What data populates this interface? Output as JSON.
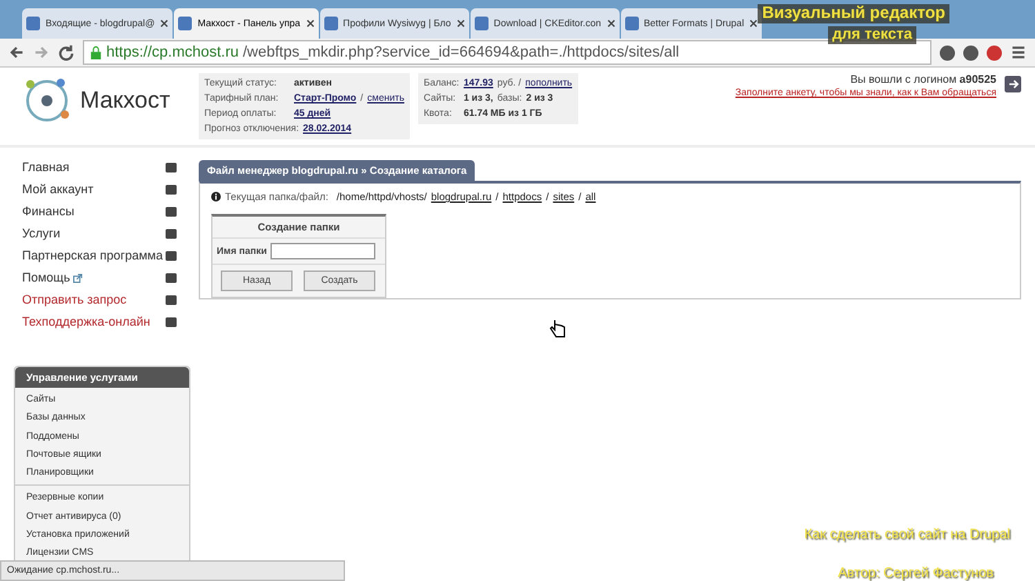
{
  "browser": {
    "tabs": [
      {
        "label": "Входящие - blogdrupal@",
        "selected": false
      },
      {
        "label": "Макхост - Панель упра",
        "selected": true
      },
      {
        "label": "Профили Wysiwyg | Бло",
        "selected": false
      },
      {
        "label": "Download | CKEditor.con",
        "selected": false
      },
      {
        "label": "Better Formats | Drupal",
        "selected": false
      }
    ],
    "url_host": "https://cp.mchost.ru",
    "url_path": "/webftps_mkdir.php?service_id=664694&path=./httpdocs/sites/all"
  },
  "header": {
    "logo": "Макхост",
    "status": [
      {
        "label": "Текущий статус:",
        "value": "активен"
      },
      {
        "label": "Тарифный план:",
        "value": "Старт-Промо",
        "sep": "/",
        "link": "сменить"
      },
      {
        "label": "Период оплаты:",
        "value": "45 дней"
      },
      {
        "label": "Прогноз отключения:",
        "value": "28.02.2014"
      }
    ],
    "account": [
      {
        "label": "Баланс:",
        "value": "147.93",
        "rest": "руб. /",
        "link": "пополнить"
      },
      {
        "label": "Сайты:",
        "value": "1 из 3,",
        "rest": "базы:",
        "value2": "2 из 3"
      },
      {
        "label": "Квота:",
        "value": "61.74 МБ из 1 ГБ"
      }
    ],
    "login_text": "Вы вошли с логином",
    "login": "a90525",
    "profile_link": "Заполните анкету, чтобы мы знали, как к Вам обращаться"
  },
  "sidebar": {
    "items": [
      {
        "label": "Главная",
        "kind": "normal"
      },
      {
        "label": "Мой аккаунт",
        "kind": "normal"
      },
      {
        "label": "Финансы",
        "kind": "normal"
      },
      {
        "label": "Услуги",
        "kind": "normal"
      },
      {
        "label": "Партнерская программа",
        "kind": "normal"
      },
      {
        "label": "Помощь",
        "kind": "external"
      },
      {
        "label": "Отправить запрос",
        "kind": "alert"
      },
      {
        "label": "Техподдержка-онлайн",
        "kind": "alert"
      }
    ],
    "services": {
      "title": "Управление услугами",
      "groups": [
        [
          "Сайты",
          "Базы данных",
          "Поддомены",
          "Почтовые ящики",
          "Планировщики"
        ],
        [
          "Резервные копии",
          "Отчет антивируса (0)",
          "Установка приложений",
          "Лицензии CMS"
        ]
      ]
    }
  },
  "panel": {
    "title": "Файл менеджер blogdrupal.ru » Создание каталога",
    "path_label": "Текущая папка/файл:",
    "path_prefix": "/home/httpd/vhosts/",
    "path_links": [
      "blogdrupal.ru",
      "httpdocs",
      "sites",
      "all"
    ],
    "path_separator": "/",
    "form": {
      "title": "Создание папки",
      "field_label": "Имя папки",
      "buttons": [
        "Назад",
        "Создать"
      ]
    }
  },
  "status_bar": "Ожидание cp.mchost.ru...",
  "captions": [
    "Визуальный редактор",
    "для текста",
    "Как сделать свой сайт на Drupal",
    "Автор: Сергей Фастунов"
  ]
}
